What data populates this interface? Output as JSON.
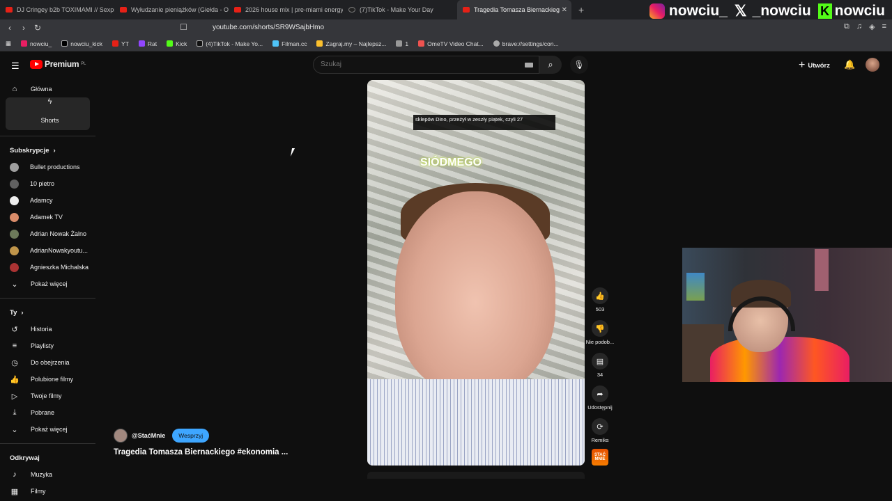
{
  "browser": {
    "tabs": [
      {
        "title": "DJ Cringey b2b TOXIMAMI // Sexpre",
        "icon": "youtube-icon"
      },
      {
        "title": "Wyłudzanie pieniążków (Giełda - Od",
        "icon": "youtube-icon"
      },
      {
        "title": "2026 house mix | pre-miami energy",
        "icon": "youtube-icon"
      },
      {
        "title": "(7)TikTok - Make Your Day",
        "icon": "tiktok-icon"
      },
      {
        "title": "Tragedia Tomasza Biernackieg",
        "icon": "youtube-icon",
        "active": true
      }
    ],
    "url": "youtube.com/shorts/SR9WSajbHmo",
    "bookmarks": [
      "nowciu_",
      "nowciu_kick",
      "YT",
      "Rat",
      "Kick",
      "(4)TikTok - Make Yo...",
      "Filman.cc",
      "Zagraj.my – Najlepsz...",
      "1",
      "OmeTV Video Chat...",
      "brave://settings/con..."
    ]
  },
  "overlay": {
    "socials": [
      "nowciu_",
      "_nowciu",
      "nowciu"
    ]
  },
  "header": {
    "logo": "Premium",
    "region": "PL",
    "search_placeholder": "Szukaj",
    "create_label": "Utwórz"
  },
  "sidebar": {
    "main": [
      {
        "label": "Główna",
        "icon": "home-icon"
      },
      {
        "label": "Shorts",
        "icon": "shorts-icon",
        "active": true
      }
    ],
    "subs_title": "Subskrypcje",
    "subs": [
      "Bullet productions",
      "10 pietro",
      "Adamcy",
      "Adamek TV",
      "Adrian Nowak Żalno",
      "AdrianNowakyoutu...",
      "Agnieszka Michalska"
    ],
    "subs_more": "Pokaż więcej",
    "you_title": "Ty",
    "you": [
      {
        "label": "Historia",
        "icon": "history-icon"
      },
      {
        "label": "Playlisty",
        "icon": "playlist-icon"
      },
      {
        "label": "Do obejrzenia",
        "icon": "clock-icon"
      },
      {
        "label": "Polubione filmy",
        "icon": "thumb-up-icon"
      },
      {
        "label": "Twoje filmy",
        "icon": "video-icon"
      },
      {
        "label": "Pobrane",
        "icon": "download-icon"
      }
    ],
    "you_more": "Pokaż więcej",
    "explore_title": "Odkrywaj",
    "explore": [
      {
        "label": "Muzyka",
        "icon": "music-icon"
      },
      {
        "label": "Filmy",
        "icon": "film-icon"
      }
    ]
  },
  "short": {
    "caption": "sklepów Dino, przeżył w zeszły piątek, czyli 27",
    "overlay_word": "SIÓDMEGO",
    "channel": "@StaćMnie",
    "support_label": "Wesprzyj",
    "title": "Tragedia Tomasza Biernackiego #ekonomia ...",
    "likes": "503",
    "dislike_label": "Nie podob...",
    "comments": "34",
    "share_label": "Udostępnij",
    "remix_label": "Remiks",
    "channel_thumb": "STAĆ MNIE"
  }
}
